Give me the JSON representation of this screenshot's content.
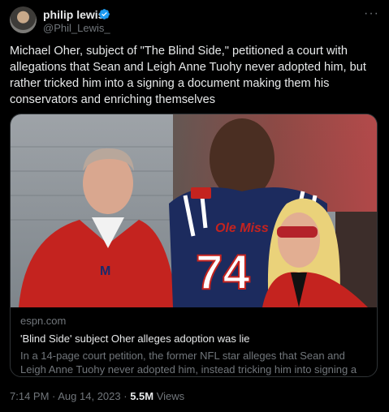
{
  "author": {
    "display_name": "philip lewis",
    "handle": "@Phil_Lewis_",
    "avatar_icon": "avatar-photo",
    "verified_icon": "verified-badge-icon"
  },
  "more_icon": "more-options-icon",
  "tweet": {
    "text": "Michael Oher, subject of \"The Blind Side,\" petitioned a court with allegations that Sean and Leigh Anne Tuohy never adopted him, but rather tricked him into a signing a document making them his conservators and enriching themselves"
  },
  "link_card": {
    "image": {
      "jersey_text": "Ole Miss",
      "jersey_number": "74",
      "jacket_logo": "M"
    },
    "domain": "espn.com",
    "title": "'Blind Side' subject Oher alleges adoption was lie",
    "description": "In a 14-page court petition, the former NFL star alleges that Sean and Leigh Anne Tuohy never adopted him, instead tricking him into signing a document ..."
  },
  "footer": {
    "time": "7:14 PM",
    "separator": " · ",
    "date": "Aug 14, 2023",
    "views_count": "5.5M",
    "views_label": "Views"
  },
  "colors": {
    "background": "#000000",
    "text_primary": "#e7e9ea",
    "text_secondary": "#71767b",
    "border": "#2f3336",
    "verified_blue": "#1d9bf0"
  }
}
